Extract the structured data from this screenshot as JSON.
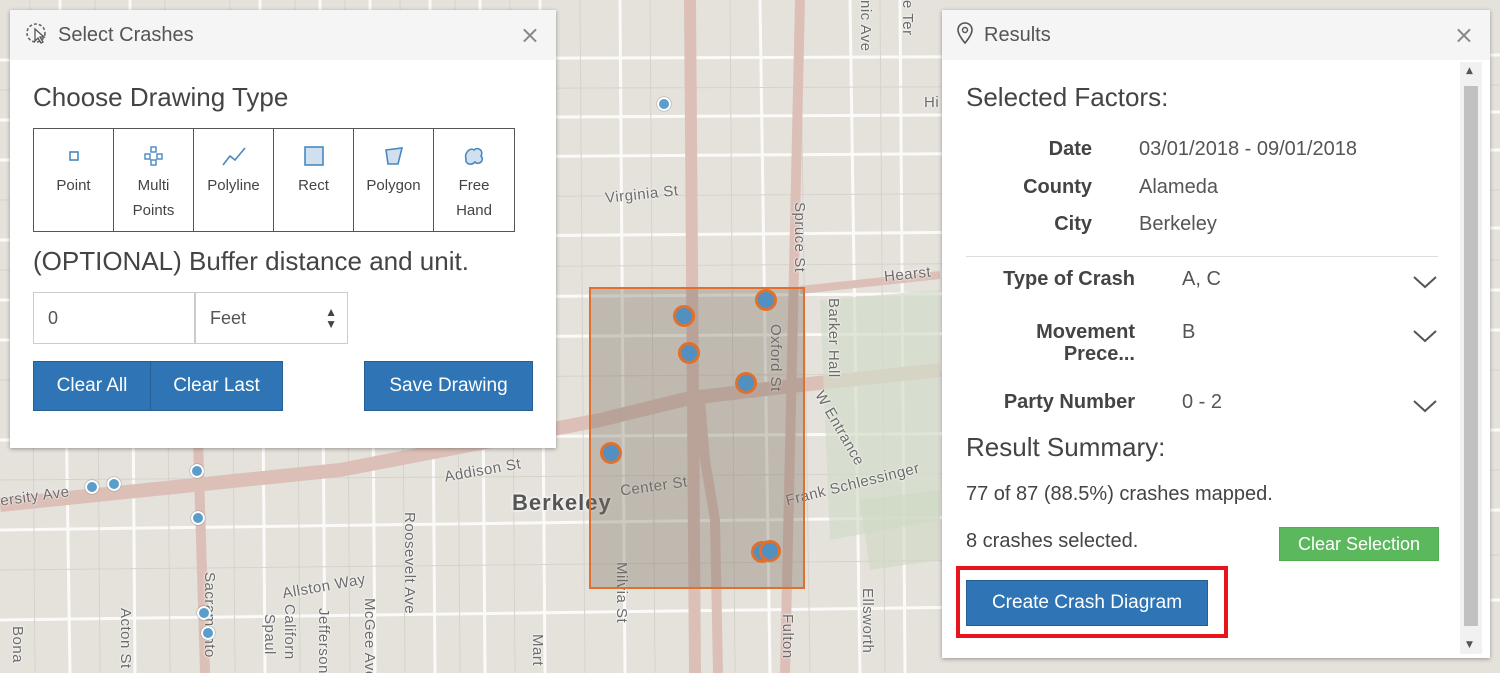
{
  "map": {
    "city_label": "Berkeley",
    "street_labels": {
      "virginia": "Virginia St",
      "addison": "Addison St",
      "center": "Center St",
      "allston": "Allston Way",
      "university": "ersity Ave",
      "frank": "Frank Schlessinger",
      "hearst": "Hearst",
      "barker": "Barker Hall",
      "oxford": "Oxford St",
      "spruce": "Spruce St",
      "milvia": "Milvia St",
      "fulton": "Fulton",
      "ellsworth": "Ellsworth",
      "roosevelt": "Roosevelt Ave",
      "mcgee": "McGee Ave",
      "jefferson": "Jefferson",
      "spaulding": "Spaul",
      "california": "Californ",
      "acton": "Acton St",
      "sacramento": "Sacramento",
      "entrance": "W Entrance",
      "bona": "Bona",
      "martin": "Mart",
      "top_ave": "nic Ave",
      "top_ter": "e Ter",
      "top_hi": "Hi"
    },
    "selection_color": "#e0702d",
    "dot_color": "#5a9dcb"
  },
  "select_panel": {
    "title": "Select Crashes",
    "title_icon": "cursor-select-icon",
    "close": "×",
    "choose_heading": "Choose Drawing Type",
    "draw_types": [
      {
        "label": "Point",
        "icon": "point-icon"
      },
      {
        "label": "Multi Points",
        "icon": "multi-points-icon"
      },
      {
        "label": "Polyline",
        "icon": "polyline-icon"
      },
      {
        "label": "Rect",
        "icon": "rect-icon"
      },
      {
        "label": "Polygon",
        "icon": "polygon-icon"
      },
      {
        "label": "Free Hand",
        "icon": "freehand-icon"
      }
    ],
    "buffer_heading": "(OPTIONAL) Buffer distance and unit.",
    "buffer_value": "0",
    "unit_value": "Feet",
    "clear_all": "Clear All",
    "clear_last": "Clear Last",
    "save_drawing": "Save Drawing"
  },
  "results_panel": {
    "title": "Results",
    "title_icon": "map-pin-icon",
    "close": "×",
    "selected_factors_heading": "Selected Factors:",
    "factors": [
      {
        "label": "Date",
        "value": "03/01/2018 - 09/01/2018"
      },
      {
        "label": "County",
        "value": "Alameda"
      },
      {
        "label": "City",
        "value": "Berkeley"
      }
    ],
    "expandable_factors": [
      {
        "label": "Type of Crash",
        "value": "A, C"
      },
      {
        "label_line1": "Movement",
        "label_line2": "Prece...",
        "value": "B"
      },
      {
        "label": "Party Number",
        "value": "0 - 2"
      }
    ],
    "result_summary_heading": "Result Summary:",
    "mapped_text": "77 of 87 (88.5%) crashes mapped.",
    "selected_text": "8 crashes selected.",
    "clear_selection": "Clear Selection",
    "create_diagram": "Create Crash Diagram",
    "highlight_color": "#e8141b"
  }
}
